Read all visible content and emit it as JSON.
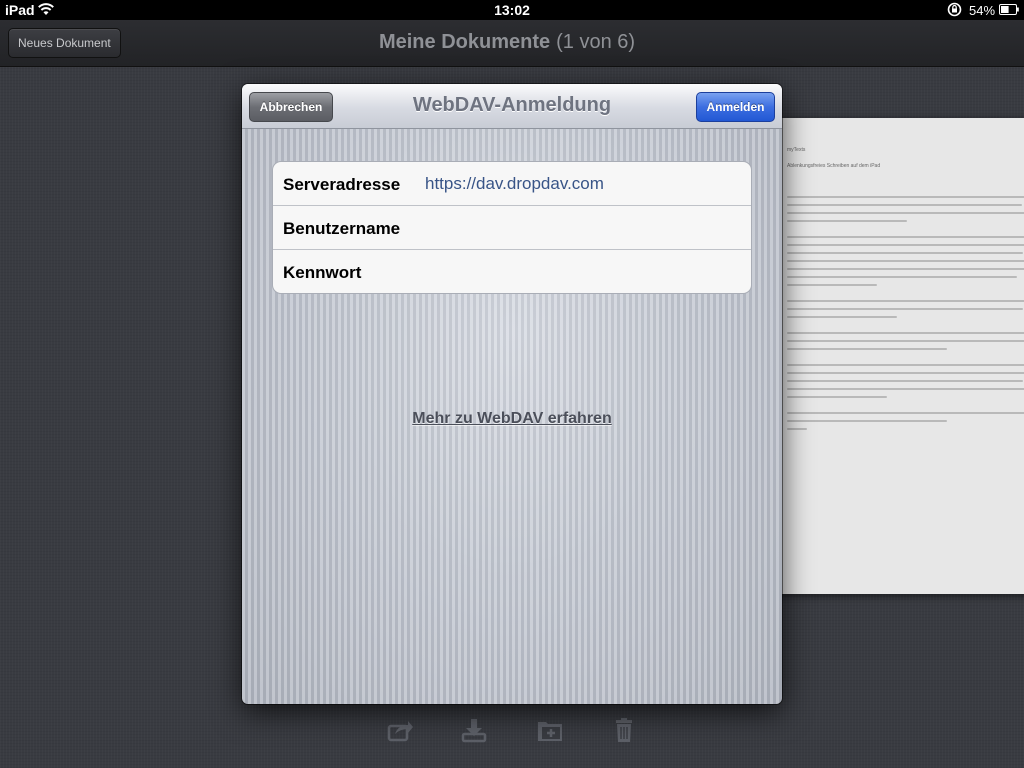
{
  "statusbar": {
    "carrier": "iPad",
    "time": "13:02",
    "battery": "54%",
    "battery_level": 0.54
  },
  "navbar": {
    "new_document": "Neues Dokument",
    "title": "Meine Dokumente",
    "count": "(1 von 6)"
  },
  "document_preview": {
    "title": "myTexts",
    "subtitle": "Ablenkungsfreies Schreiben auf dem iPad"
  },
  "modal": {
    "title": "WebDAV-Anmeldung",
    "cancel": "Abbrechen",
    "login": "Anmelden",
    "fields": [
      {
        "label": "Serveradresse",
        "value": "https://dav.dropdav.com",
        "placeholder": ""
      },
      {
        "label": "Benutzername",
        "value": "",
        "placeholder": ""
      },
      {
        "label": "Kennwort",
        "value": "",
        "placeholder": ""
      }
    ],
    "learn_more": "Mehr zu WebDAV erfahren"
  },
  "toolbar": {
    "icons": [
      "share-icon",
      "download-icon",
      "add-folder-icon",
      "trash-icon"
    ]
  },
  "colors": {
    "accent_blue": "#2258d4",
    "link_text": "#385487",
    "background": "#393b41"
  }
}
